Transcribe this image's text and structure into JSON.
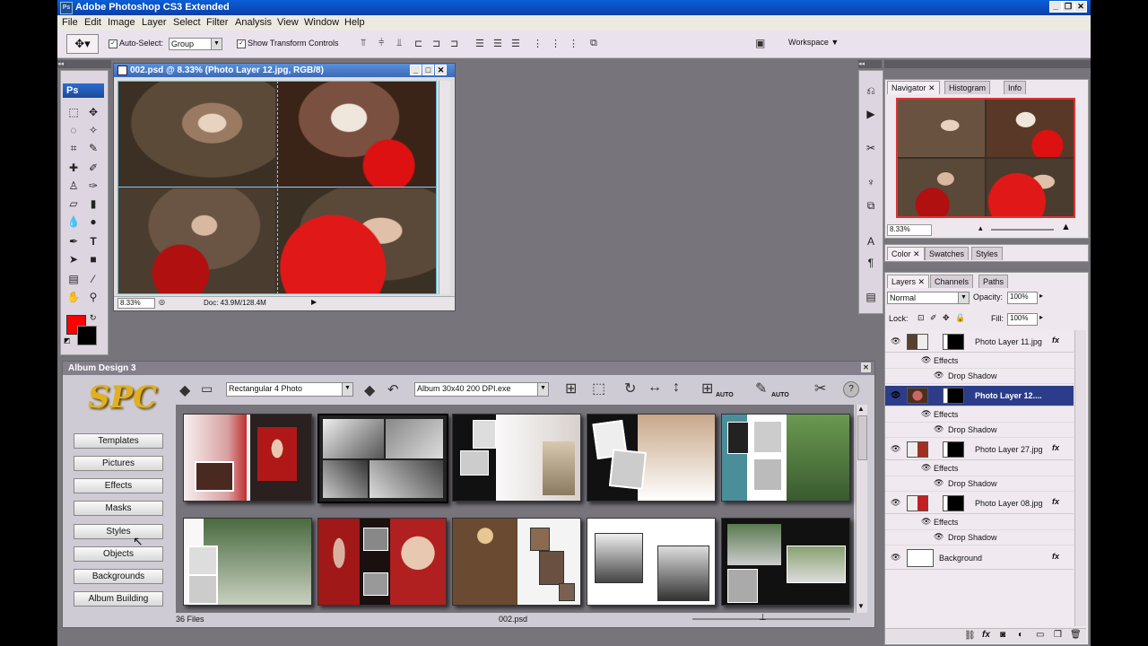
{
  "app": {
    "title": "Adobe Photoshop CS3 Extended",
    "ps_badge": "Ps"
  },
  "menu": [
    "File",
    "Edit",
    "Image",
    "Layer",
    "Select",
    "Filter",
    "Analysis",
    "View",
    "Window",
    "Help"
  ],
  "options": {
    "auto_select_label": "Auto-Select:",
    "auto_select_value": "Group",
    "show_transform_label": "Show Transform Controls",
    "workspace_label": "Workspace"
  },
  "document": {
    "title": "002.psd @ 8.33% (Photo Layer 12.jpg, RGB/8)",
    "zoom": "8.33%",
    "doc_info": "Doc: 43.9M/128.4M"
  },
  "navigator": {
    "tabs": [
      "Navigator",
      "Histogram",
      "Info"
    ],
    "zoom": "8.33%"
  },
  "color_panel": {
    "tabs": [
      "Color",
      "Swatches",
      "Styles"
    ]
  },
  "layers_panel": {
    "tabs": [
      "Layers",
      "Channels",
      "Paths"
    ],
    "blend_mode": "Normal",
    "opacity_label": "Opacity:",
    "opacity": "100%",
    "lock_label": "Lock:",
    "fill_label": "Fill:",
    "fill": "100%",
    "effects_label": "Effects",
    "drop_shadow_label": "Drop Shadow",
    "fx_label": "fx",
    "layers": [
      {
        "name": "Photo Layer 11.jpg"
      },
      {
        "name": "Photo Layer 12...."
      },
      {
        "name": "Photo Layer 27.jpg"
      },
      {
        "name": "Photo Layer 08.jpg"
      },
      {
        "name": "Background"
      }
    ]
  },
  "album": {
    "title": "Album Design 3",
    "logo": "SPC",
    "layout_select": "Rectangular 4 Photo",
    "size_select": "Album 30x40  200 DPI.exe",
    "auto_label": "AUTO",
    "buttons": [
      "Templates",
      "Pictures",
      "Effects",
      "Masks",
      "Styles",
      "Objects",
      "Backgrounds",
      "Album Building"
    ],
    "file_count": "36 Files",
    "current_file": "002.psd"
  },
  "colors": {
    "foreground": "#ff0000",
    "background": "#000000",
    "accent": "#0a3fa8"
  }
}
